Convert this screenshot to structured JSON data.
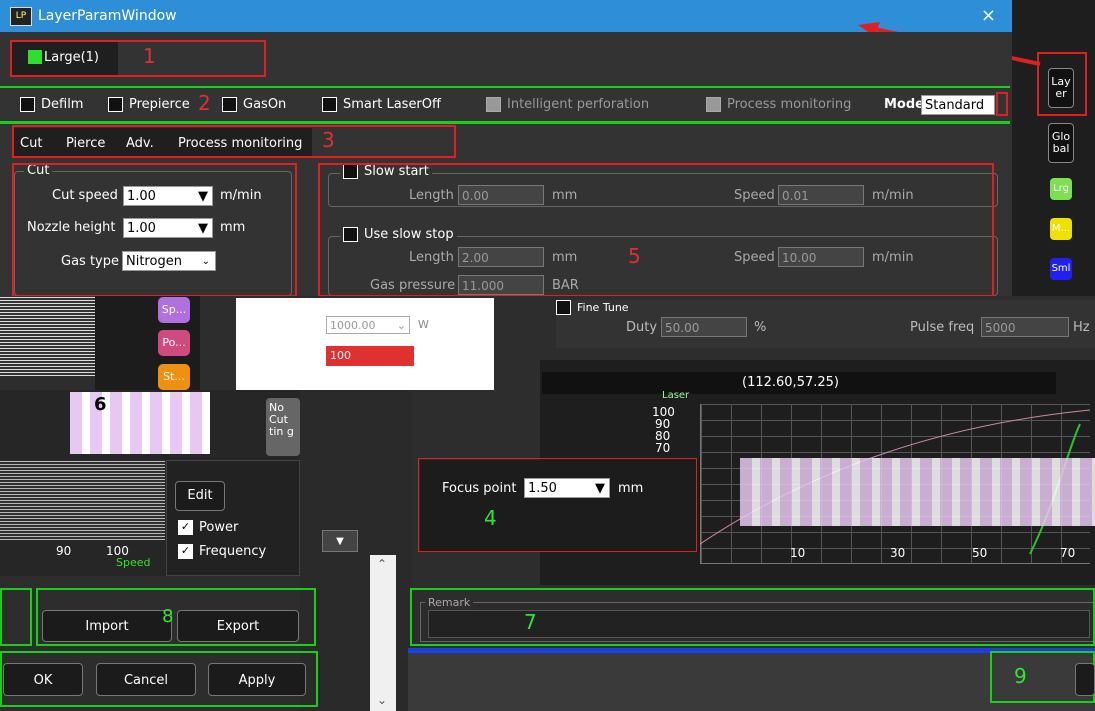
{
  "window": {
    "title": "LayerParamWindow",
    "close": "×"
  },
  "layer_tab": {
    "label": "Large(1)"
  },
  "options": {
    "defilm": "Defilm",
    "prepierce": "Prepierce",
    "gason": "GasOn",
    "smart_laser_off": "Smart LaserOff",
    "intelligent_perforation": "Intelligent perforation",
    "process_monitoring": "Process monitoring",
    "mode_label": "Mode",
    "mode_value": "Standard"
  },
  "tabs": [
    "Cut",
    "Pierce",
    "Adv.",
    "Process monitoring"
  ],
  "cut": {
    "legend": "Cut",
    "cut_speed_label": "Cut speed",
    "cut_speed_value": "1.00",
    "cut_speed_unit": "m/min",
    "nozzle_height_label": "Nozzle height",
    "nozzle_height_value": "1.00",
    "nozzle_height_unit": "mm",
    "gas_type_label": "Gas type",
    "gas_type_value": "Nitrogen"
  },
  "slow_start": {
    "label": "Slow start",
    "length_label": "Length",
    "length_value": "0.00",
    "length_unit": "mm",
    "speed_label": "Speed",
    "speed_value": "0.01",
    "speed_unit": "m/min"
  },
  "slow_stop": {
    "label": "Use slow stop",
    "length_label": "Length",
    "length_value": "2.00",
    "length_unit": "mm",
    "speed_label": "Speed",
    "speed_value": "10.00",
    "speed_unit": "m/min",
    "gas_label": "Gas pressure",
    "gas_value": "11.000",
    "gas_unit": "BAR"
  },
  "side": {
    "layer": "Lay er",
    "global": "Glo bal",
    "lrg": "Lrg",
    "m": "M...",
    "sml": "Sml"
  },
  "fine_tune": {
    "label": "Fine Tune",
    "duty_label": "Duty",
    "duty_value": "50.00",
    "duty_unit": "%",
    "pulse_label": "Pulse freq",
    "pulse_value": "5000",
    "pulse_unit": "Hz"
  },
  "mini_buttons": {
    "sp": "Sp...",
    "po": "Po...",
    "st": "St..."
  },
  "center_dialog": {
    "power_value": "1000.00",
    "power_unit": "W",
    "red_value": "100"
  },
  "coord": "(112.60,57.25)",
  "laser_axis": {
    "title": "Laser",
    "ticks": [
      "100",
      "90",
      "80",
      "70"
    ]
  },
  "no_cutting": "No Cut tin g",
  "edit_menu": {
    "edit": "Edit",
    "power": "Power",
    "frequency": "Frequency"
  },
  "focus": {
    "label": "Focus point",
    "value": "1.50",
    "unit": "mm"
  },
  "left_axis": {
    "ticks": [
      "90",
      "100"
    ],
    "speed": "Speed"
  },
  "right_axis": {
    "ticks": [
      "10",
      "30",
      "50",
      "70"
    ]
  },
  "remark_label": "Remark",
  "actions": {
    "import": "Import",
    "export": "Export",
    "ok": "OK",
    "cancel": "Cancel",
    "apply": "Apply"
  },
  "annotations": [
    "1",
    "2",
    "3",
    "4",
    "5",
    "6",
    "7",
    "8",
    "9"
  ]
}
